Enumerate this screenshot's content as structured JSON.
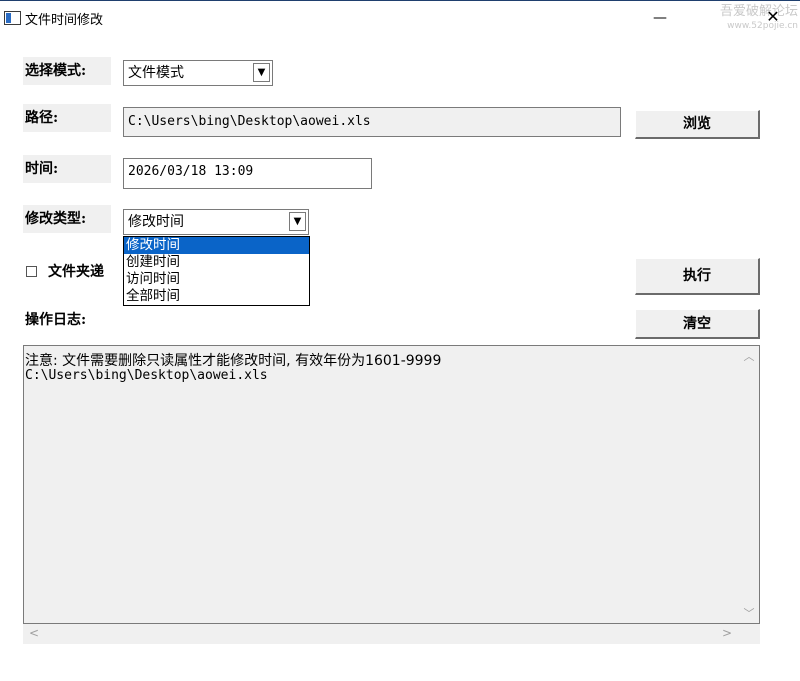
{
  "window": {
    "title": "文件时间修改",
    "minimize_glyph": "—",
    "close_glyph": "✕",
    "watermark": "吾爱破解论坛",
    "watermark_url": "www.52pojie.cn"
  },
  "mode": {
    "label": "选择模式:",
    "value": "文件模式"
  },
  "path": {
    "label": "路径:",
    "value": "C:\\Users\\bing\\Desktop\\aowei.xls",
    "browse_label": "浏览"
  },
  "time": {
    "label": "时间:",
    "value": "2026/03/18 13:09"
  },
  "modify_type": {
    "label": "修改类型:",
    "value": "修改时间",
    "options": [
      "修改时间",
      "创建时间",
      "访问时间",
      "全部时间"
    ]
  },
  "folder_recursive": {
    "label": "文件夹递",
    "checked": false
  },
  "execute_label": "执行",
  "log": {
    "label": "操作日志:",
    "clear_label": "清空",
    "lines": [
      "注意: 文件需要删除只读属性才能修改时间, 有效年份为1601-9999",
      "C:\\Users\\bing\\Desktop\\aowei.xls"
    ]
  },
  "colors": {
    "selection": "#0a64c8",
    "panel": "#f0f0f0"
  }
}
